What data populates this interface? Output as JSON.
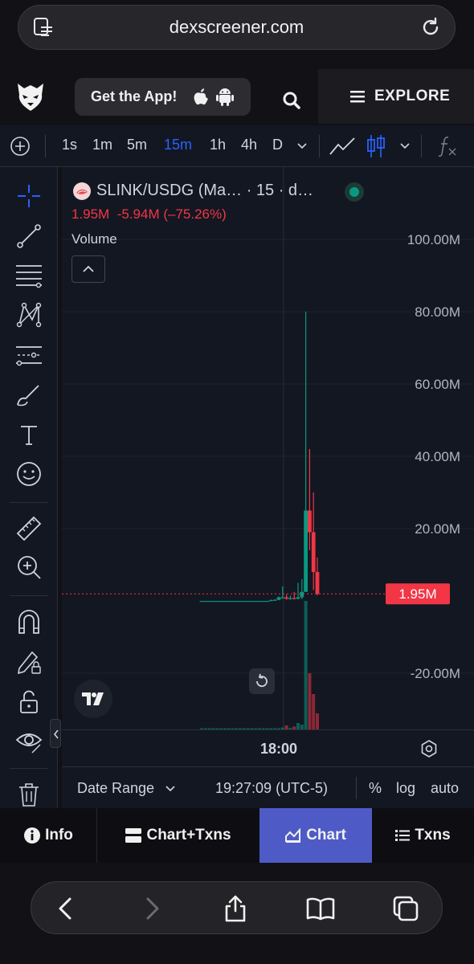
{
  "browser": {
    "host": "dexscreener.com"
  },
  "header": {
    "get_app": "Get the App!",
    "explore": "EXPLORE"
  },
  "toolbar": {
    "intervals": [
      "1s",
      "1m",
      "5m",
      "15m",
      "1h",
      "4h",
      "D"
    ],
    "active_interval": "15m"
  },
  "legend": {
    "symbol": "SLINK/USDG (Ma…  · 15 · d…",
    "price": "1.95M",
    "change": "-5.94M",
    "change_pct": "(–75.26%)",
    "volume_label": "Volume"
  },
  "chart_data": {
    "type": "candlestick",
    "y_tick_labels": [
      "100.00M",
      "80.00M",
      "60.00M",
      "40.00M",
      "20.00M",
      "-20.00M"
    ],
    "y_ticks": [
      100,
      80,
      60,
      40,
      20,
      -20
    ],
    "ylim": [
      -38,
      110
    ],
    "current_price_label": "1.95M",
    "current_price": 1.95,
    "x_tick_label": "18:00",
    "up_color": "#089981",
    "down_color": "#f23645",
    "candles": [
      {
        "o": 0.0,
        "h": 0.0,
        "l": 0.0,
        "c": 0.0
      },
      {
        "o": 0.0,
        "h": 0.0,
        "l": 0.0,
        "c": 0.0
      },
      {
        "o": 0.0,
        "h": 0.0,
        "l": 0.0,
        "c": 0.0
      },
      {
        "o": 0.0,
        "h": 0.0,
        "l": 0.0,
        "c": 0.0
      },
      {
        "o": 0.0,
        "h": 0.0,
        "l": 0.0,
        "c": 0.0
      },
      {
        "o": 0.0,
        "h": 0.0,
        "l": 0.0,
        "c": 0.0
      },
      {
        "o": 0.0,
        "h": 0.0,
        "l": 0.0,
        "c": 0.0
      },
      {
        "o": 0.0,
        "h": 0.0,
        "l": 0.0,
        "c": 0.0
      },
      {
        "o": 0.0,
        "h": 0.0,
        "l": 0.0,
        "c": 0.0
      },
      {
        "o": 0.0,
        "h": 0.0,
        "l": 0.0,
        "c": 0.0
      },
      {
        "o": 0.0,
        "h": 0.0,
        "l": 0.0,
        "c": 0.0
      },
      {
        "o": 0.0,
        "h": 0.0,
        "l": 0.0,
        "c": 0.0
      },
      {
        "o": 0.0,
        "h": 0.0,
        "l": 0.0,
        "c": 0.0
      },
      {
        "o": 0.0,
        "h": 0.0,
        "l": 0.0,
        "c": 0.0
      },
      {
        "o": 0.0,
        "h": 0.0,
        "l": 0.0,
        "c": 0.0
      },
      {
        "o": 0.0,
        "h": 0.0,
        "l": 0.0,
        "c": 0.0
      },
      {
        "o": 0.0,
        "h": 0.0,
        "l": 0.0,
        "c": 0.0
      },
      {
        "o": 0.0,
        "h": 0.0,
        "l": 0.0,
        "c": 0.0
      },
      {
        "o": 0.0,
        "h": 0.4,
        "l": 0.0,
        "c": 0.2
      },
      {
        "o": 0.2,
        "h": 0.5,
        "l": 0.1,
        "c": 0.3
      },
      {
        "o": 0.3,
        "h": 1.2,
        "l": 0.2,
        "c": 1.0
      },
      {
        "o": 1.0,
        "h": 4.0,
        "l": 0.6,
        "c": 1.0
      },
      {
        "o": 1.0,
        "h": 1.8,
        "l": 0.3,
        "c": 0.6
      },
      {
        "o": 0.6,
        "h": 1.5,
        "l": 0.3,
        "c": 0.8
      },
      {
        "o": 0.8,
        "h": 2.5,
        "l": 0.4,
        "c": 0.6
      },
      {
        "o": 0.6,
        "h": 5.0,
        "l": 0.4,
        "c": 1.0
      },
      {
        "o": 1.0,
        "h": 6.0,
        "l": 0.5,
        "c": 2.5
      },
      {
        "o": 2.5,
        "h": 80.0,
        "l": 4.0,
        "c": 25.0
      },
      {
        "o": 25.0,
        "h": 42.0,
        "l": 14.0,
        "c": 19.0
      },
      {
        "o": 19.0,
        "h": 30.0,
        "l": 3.0,
        "c": 8.0
      },
      {
        "o": 8.0,
        "h": 12.0,
        "l": 1.5,
        "c": 1.95
      }
    ],
    "volumes": [
      0.3,
      0.3,
      0.3,
      0.3,
      0.3,
      0.3,
      0.3,
      0.3,
      0.3,
      0.3,
      0.3,
      0.3,
      0.3,
      0.3,
      0.3,
      0.3,
      0.3,
      0.3,
      0.5,
      0.8,
      0.6,
      1.2,
      2.5,
      1.0,
      1.8,
      4.0,
      3.0,
      80.0,
      35.0,
      22.0,
      10.0
    ]
  },
  "time_axis": {
    "label": "18:00"
  },
  "bottom": {
    "date_range": "Date Range",
    "clock": "19:27:09 (UTC-5)",
    "percent": "%",
    "log": "log",
    "auto": "auto"
  },
  "tabs": [
    {
      "label": "Info"
    },
    {
      "label": "Chart+Txns"
    },
    {
      "label": "Chart"
    },
    {
      "label": "Txns"
    }
  ],
  "colors": {
    "accent": "#2962ff",
    "tab_active": "#4e5bc6",
    "price_red": "#f23645",
    "live_dot": "#089981"
  }
}
